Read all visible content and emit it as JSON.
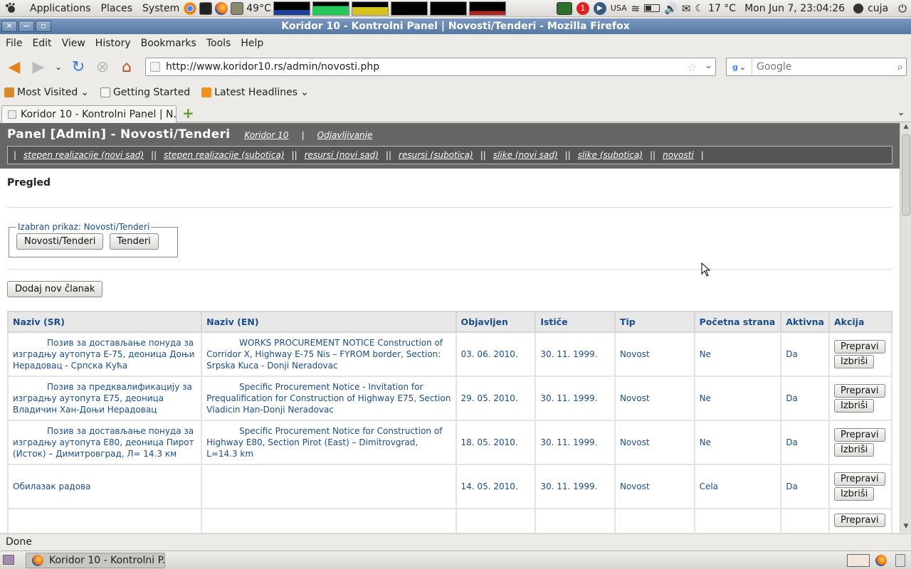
{
  "topbar": {
    "menus": [
      "Applications",
      "Places",
      "System"
    ],
    "cpu_temp": "49°C",
    "kb_layout": "USA",
    "weather": "17 °C",
    "clock": "Mon Jun  7, 23:04:26",
    "user": "cuja",
    "notify_badge": "1"
  },
  "window": {
    "title": "Koridor 10 - Kontrolni Panel | Novosti/Tenderi - Mozilla Firefox"
  },
  "menubar": [
    "File",
    "Edit",
    "View",
    "History",
    "Bookmarks",
    "Tools",
    "Help"
  ],
  "navbar": {
    "url": "http://www.koridor10.rs/admin/novosti.php",
    "search_placeholder": "Google"
  },
  "bookmarks": [
    "Most Visited",
    "Getting Started",
    "Latest Headlines"
  ],
  "tab": {
    "title": "Koridor 10 - Kontrolni Panel | N..."
  },
  "panel": {
    "title": "Panel [Admin] - Novosti/Tenderi",
    "link_home": "Koridor 10",
    "link_sep": "|",
    "link_logout": "Odjavljivanje",
    "nav_links": [
      "stepen realizacije (novi sad)",
      "stepen realizacije (subotica)",
      "resursi (novi sad)",
      "resursi (subotica)",
      "slike (novi sad)",
      "slike (subotica)",
      "novosti"
    ],
    "nav_sep_single": "|",
    "nav_sep_double": "||"
  },
  "overview": {
    "heading": "Pregled",
    "legend": "Izabran prikaz: Novosti/Tenderi",
    "btn_news_tenders": "Novosti/Tenderi",
    "btn_tenders": "Tenderi",
    "btn_add": "Dodaj nov članak"
  },
  "table": {
    "headers": [
      "Naziv (SR)",
      "Naziv (EN)",
      "Objavljen",
      "Ističe",
      "Tip",
      "Početna strana",
      "Aktivna",
      "Akcija"
    ],
    "edit_label": "Prepravi",
    "delete_label": "Izbriši",
    "rows": [
      {
        "sr": "Позив за достављање понуда за изградњу аутопута Е-75, деоница Доњи Нерадовац - Српска Кућа",
        "en": "WORKS PROCUREMENT NOTICE Construction of Corridor X, Highway E-75 Nis – FYROM border, Section: Srpska Kuca - Donji Neradovac",
        "published": "03. 06. 2010.",
        "expires": "30. 11. 1999.",
        "type": "Novost",
        "home": "Ne",
        "active": "Da"
      },
      {
        "sr": "Позив за предквалификацију за изградњу аутопута Е75, деоница Владичин Хан-Доњи Нерадовац",
        "en": "Specific Procurement Notice - Invitation for Prequalification for Construction of Highway E75, Section Vladicin Han-Donji Neradovac",
        "published": "29. 05. 2010.",
        "expires": "30. 11. 1999.",
        "type": "Novost",
        "home": "Ne",
        "active": "Da"
      },
      {
        "sr": "Позив за достављање понуда за изградњу аутопута Е80, деоница Пирот (Исток) – Димитровград, Л= 14.3 км",
        "en": "Specific Procurement Notice for Construction of Highway E80, Section Pirot (East) – Dimitrovgrad, L=14.3 km",
        "published": "18. 05. 2010.",
        "expires": "30. 11. 1999.",
        "type": "Novost",
        "home": "Ne",
        "active": "Da"
      },
      {
        "sr": "Обилазак радова",
        "en": "",
        "published": "14. 05. 2010.",
        "expires": "30. 11. 1999.",
        "type": "Novost",
        "home": "Cela",
        "active": "Da"
      },
      {
        "sr": "",
        "en": "",
        "published": "",
        "expires": "",
        "type": "",
        "home": "",
        "active": ""
      }
    ]
  },
  "status": {
    "text": "Done"
  },
  "taskbar": {
    "window_label": "Koridor 10 - Kontrolni P..."
  }
}
